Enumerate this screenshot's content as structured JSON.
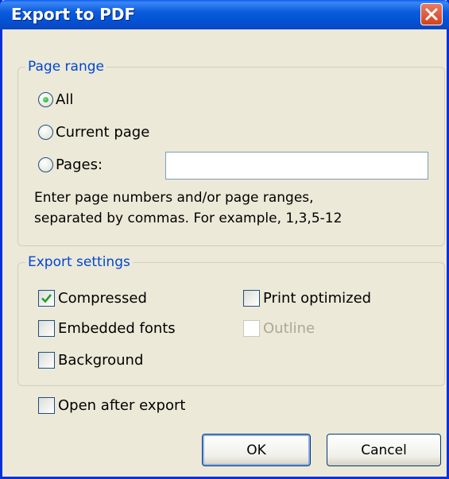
{
  "window": {
    "title": "Export to PDF",
    "close_icon": "close-icon"
  },
  "page_range": {
    "legend": "Page range",
    "options": [
      {
        "label": "All",
        "selected": true
      },
      {
        "label": "Current page",
        "selected": false
      },
      {
        "label": "Pages:",
        "selected": false
      }
    ],
    "pages_input": {
      "value": "",
      "placeholder": ""
    },
    "hint_line1": "Enter page numbers and/or page ranges,",
    "hint_line2": "separated by commas. For example, 1,3,5-12"
  },
  "export_settings": {
    "legend": "Export settings",
    "compressed": {
      "label": "Compressed",
      "checked": true
    },
    "embedded_fonts": {
      "label": "Embedded fonts",
      "checked": false
    },
    "background": {
      "label": "Background",
      "checked": false
    },
    "print_optimized": {
      "label": "Print optimized",
      "checked": false
    },
    "outline": {
      "label": "Outline",
      "checked": false,
      "enabled": false
    }
  },
  "open_after_export": {
    "label": "Open after export",
    "checked": false
  },
  "buttons": {
    "ok": "OK",
    "cancel": "Cancel"
  },
  "colors": {
    "title_bar": "#0a5ef0",
    "group_legend": "#0046d5",
    "dialog_bg": "#ece9d8",
    "check_mark": "#21a121"
  }
}
